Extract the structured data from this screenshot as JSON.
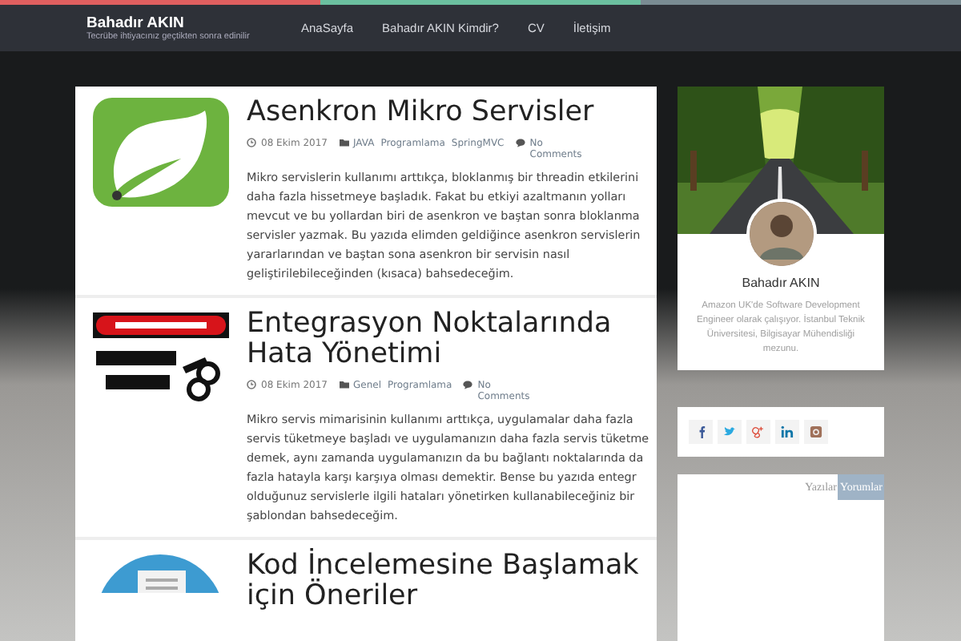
{
  "site": {
    "title": "Bahadır AKIN",
    "tagline": "Tecrübe ihtiyacınız geçtikten sonra edinilir"
  },
  "nav": [
    {
      "label": "AnaSayfa"
    },
    {
      "label": "Bahadır AKIN Kimdir?"
    },
    {
      "label": "CV"
    },
    {
      "label": "İletişim"
    }
  ],
  "posts": [
    {
      "kind": "leaf",
      "title": "Asenkron Mikro Servisler",
      "date": "08 Ekim 2017",
      "categories": [
        "JAVA",
        "Programlama",
        "SpringMVC"
      ],
      "comments": "No Comments",
      "excerpt": "Mikro servislerin kullanımı arttıkça, bloklanmış bir threadin etkilerini daha fazla hissetmeye başladık. Fakat bu etkiyi azaltmanın yolları mevcut ve bu yollardan biri de asenkron ve baştan sonra bloklanma servisler yazmak. Bu yazıda elimden geldiğince asenkron servislerin yararlarından ve baştan sona asenkron bir servisin nasıl geliştirilebileceğinden (kısaca) bahsedeceğim."
    },
    {
      "kind": "sign",
      "title": "Entegrasyon Noktalarında Hata Yönetimi",
      "date": "08 Ekim 2017",
      "categories": [
        "Genel",
        "Programlama"
      ],
      "comments": "No Comments",
      "excerpt": "Mikro servis mimarisinin kullanımı arttıkça, uygulamalar daha fazla servis tüketmeye başladı ve uygulamanızın daha fazla servis tüketme demek, aynı zamanda uygulamanızın da bu bağlantı noktalarında da fazla hatayla karşı karşıya olması demektir. Bense bu yazıda entegr olduğunuz servislerle ilgili hataları yönetirken kullanabileceğiniz bir şablondan bahsedeceğim."
    },
    {
      "kind": "document",
      "title": "Kod İncelemesine Başlamak için Öneriler"
    }
  ],
  "profile": {
    "name": "Bahadır AKIN",
    "bio": "Amazon UK'de Software Development Engineer olarak çalışıyor. İstanbul Teknik Üniversitesi, Bilgisayar Mühendisliği mezunu."
  },
  "social": [
    {
      "kind": "facebook"
    },
    {
      "kind": "twitter"
    },
    {
      "kind": "googleplus"
    },
    {
      "kind": "linkedin"
    },
    {
      "kind": "instagram"
    }
  ],
  "tabs": [
    {
      "label": "Yazılar",
      "selected": false
    },
    {
      "label": "Yorumlar",
      "selected": true
    }
  ]
}
